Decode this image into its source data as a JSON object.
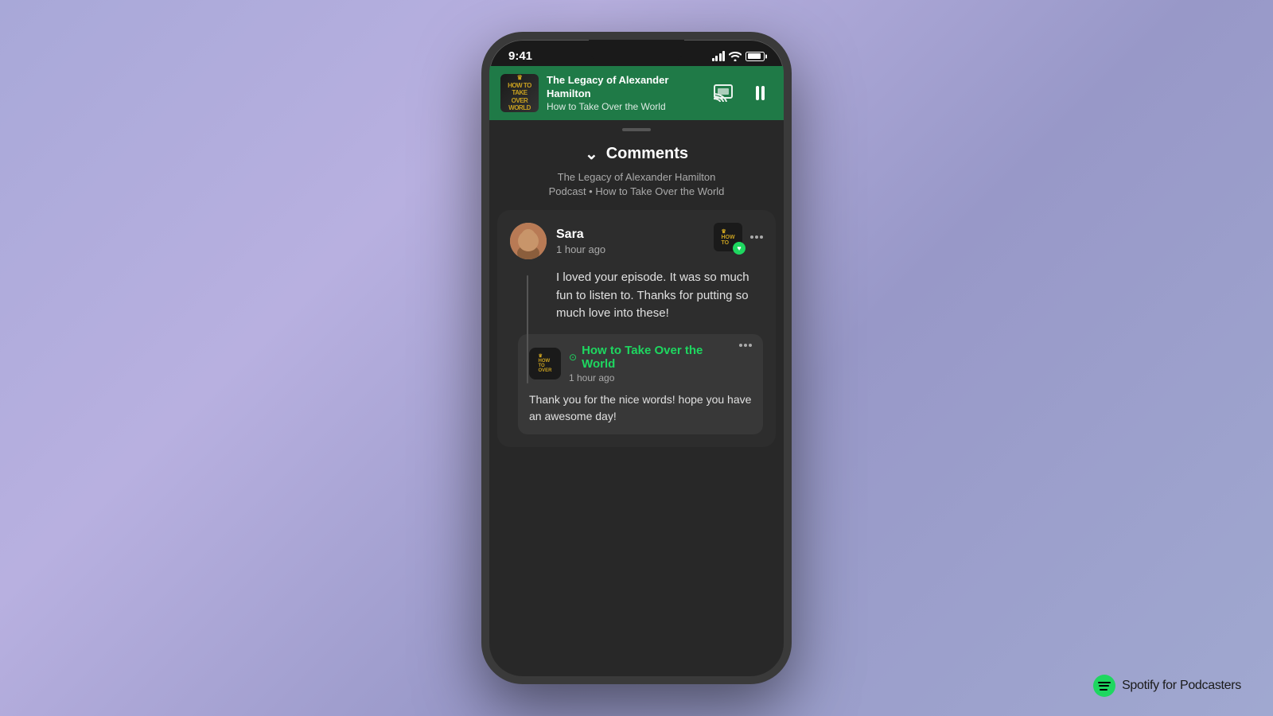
{
  "background": {
    "color": "#a8b0d8"
  },
  "phone": {
    "status_bar": {
      "time": "9:41",
      "signal": "●●●",
      "wifi": "wifi",
      "battery": "battery"
    },
    "now_playing": {
      "podcast_name": "The Legacy of Alexander Hamilton",
      "episode_name": "How to Take Over the World",
      "thumbnail_text": "HOW TO TAKE OVER WORLD"
    },
    "comments": {
      "title": "Comments",
      "subtitle_line1": "The Legacy of Alexander Hamilton",
      "subtitle_line2": "Podcast • How to Take Over the World"
    },
    "main_comment": {
      "username": "Sara",
      "time_ago": "1 hour ago",
      "text": "I loved your episode. It was so much fun to listen to. Thanks for putting so much love into these!",
      "more_label": "..."
    },
    "reply": {
      "podcast_name": "How to Take Over the World",
      "time_ago": "1 hour ago",
      "text": "Thank you for the nice words! hope you have an awesome day!",
      "thumbnail_text": "HOW TO TAKE OVER WORLD"
    }
  },
  "branding": {
    "text": "Spotify",
    "subtext": " for Podcasters"
  }
}
